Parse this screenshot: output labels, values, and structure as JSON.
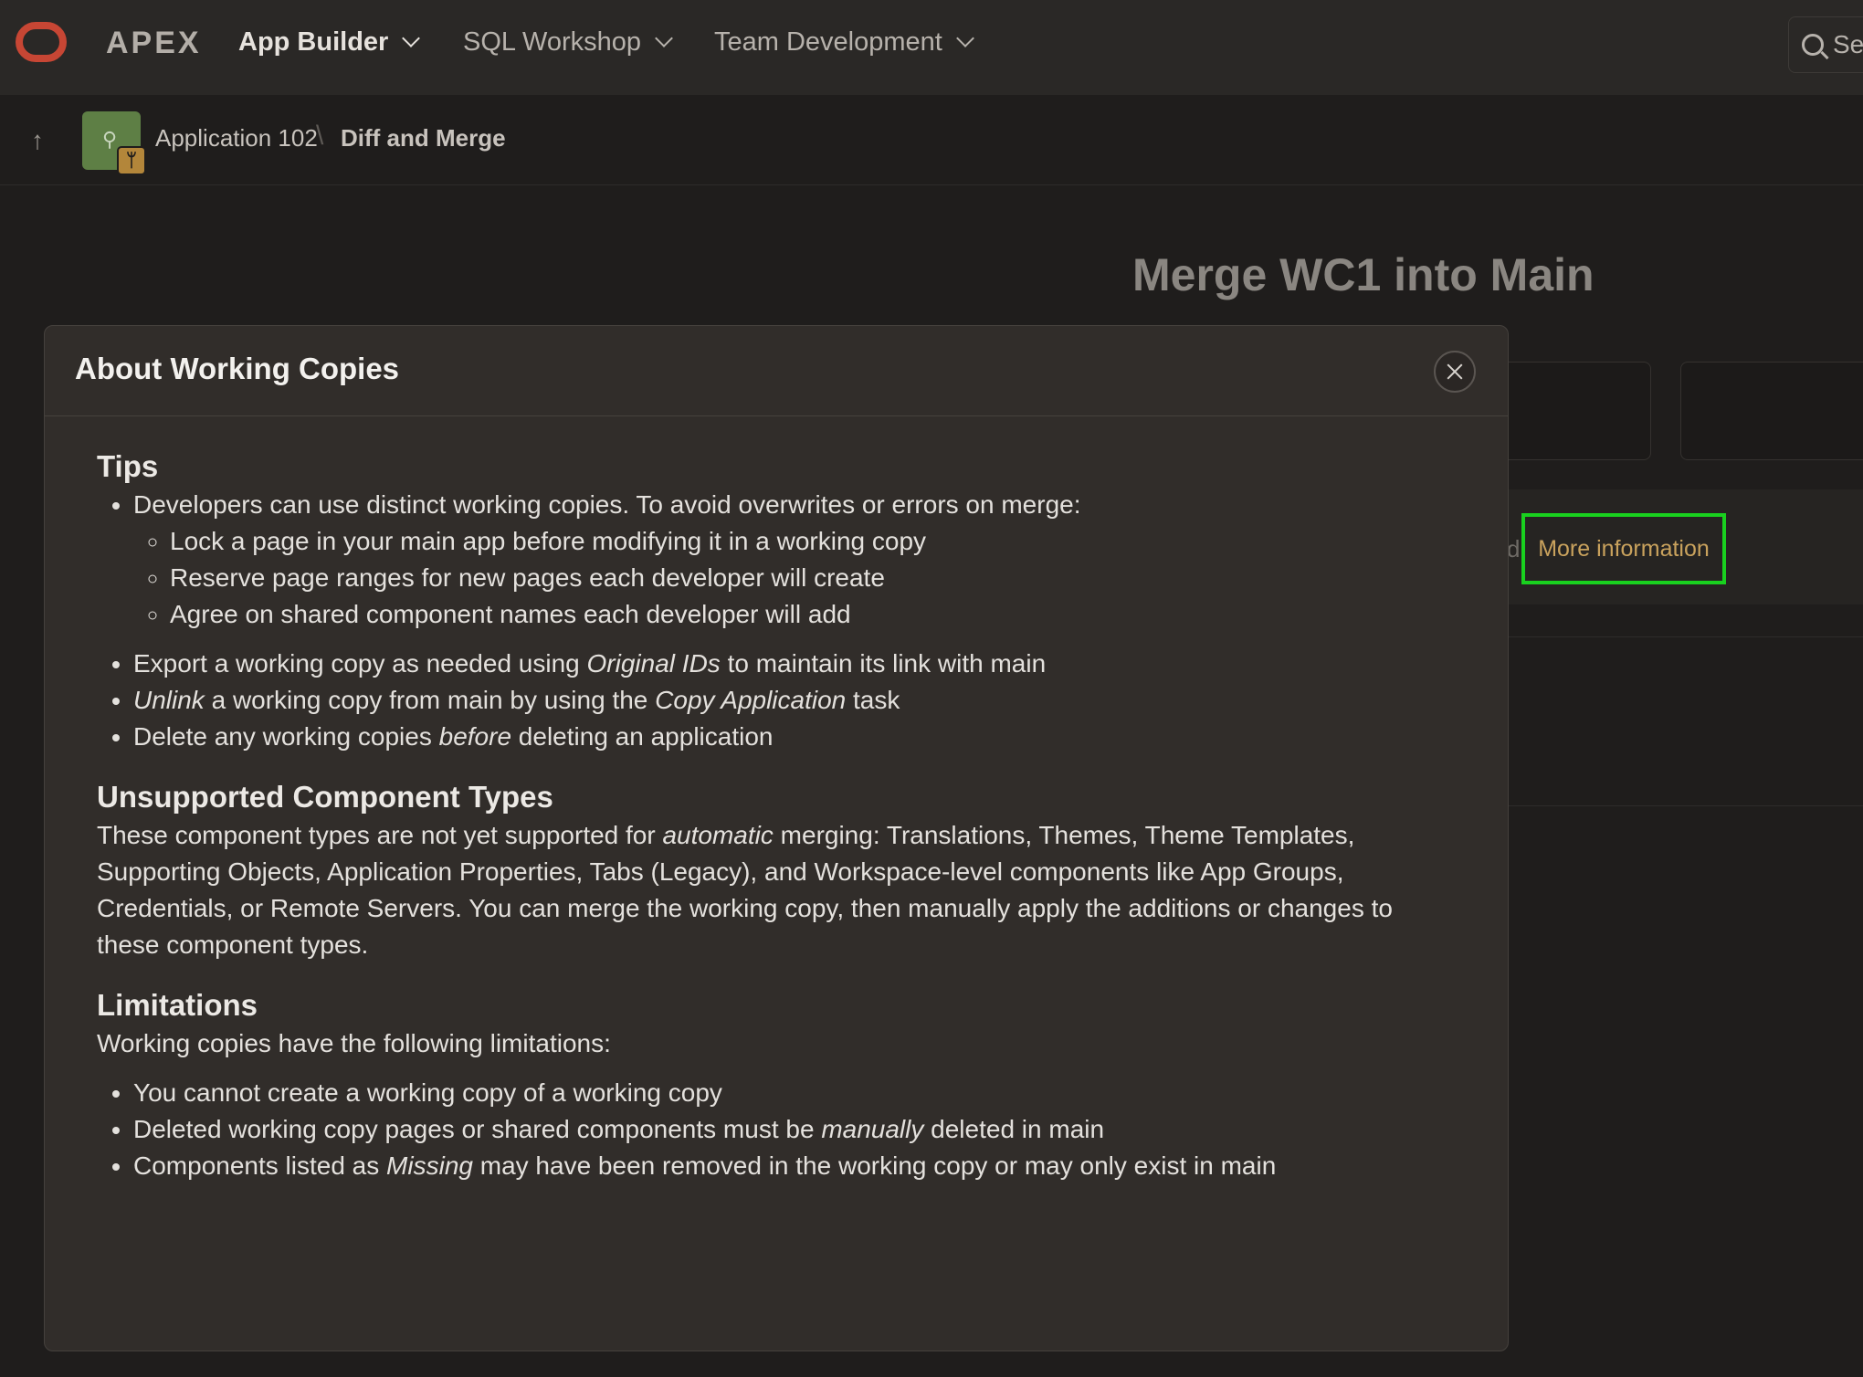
{
  "topbar": {
    "brand": "APEX",
    "nav": [
      {
        "label": "App Builder",
        "active": true
      },
      {
        "label": "SQL Workshop",
        "active": false
      },
      {
        "label": "Team Development",
        "active": false
      }
    ],
    "search_placeholder": "Se",
    "brand_color": "#c74634"
  },
  "breadcrumb": {
    "app": "Application 102",
    "separator": "\\",
    "current": "Diff and Merge"
  },
  "page": {
    "title": "Merge WC1 into Main",
    "stray_char": "d",
    "more_info_label": "More information",
    "highlight_color": "#19d11f"
  },
  "dialog": {
    "title": "About Working Copies",
    "tips": {
      "heading": "Tips",
      "intro": "Developers can use distinct working copies. To avoid overwrites or errors on merge:",
      "sub": [
        "Lock a page in your main app before modifying it in a working copy",
        "Reserve page ranges for new pages each developer will create",
        "Agree on shared component names each developer will add"
      ],
      "b2_pre": "Export a working copy as needed using ",
      "b2_em": "Original IDs",
      "b2_post": " to maintain its link with main",
      "b3_em": "Unlink",
      "b3_mid": " a working copy from main by using the ",
      "b3_em2": "Copy Application",
      "b3_post": " task",
      "b4_pre": "Delete any working copies ",
      "b4_em": "before",
      "b4_post": " deleting an application"
    },
    "unsupported": {
      "heading": "Unsupported Component Types",
      "pre": "These component types are not yet supported for ",
      "em": "automatic",
      "post": " merging: Translations, Themes, Theme Templates, Supporting Objects, Application Properties, Tabs (Legacy), and Workspace-level components like App Groups, Credentials, or Remote Servers. You can merge the working copy, then manually apply the additions or changes to these component types."
    },
    "limitations": {
      "heading": "Limitations",
      "intro": "Working copies have the following limitations:",
      "l1": "You cannot create a working copy of a working copy",
      "l2_pre": "Deleted working copy pages or shared components must be ",
      "l2_em": "manually",
      "l2_post": " deleted in main",
      "l3_pre": "Components listed as ",
      "l3_em": "Missing",
      "l3_post": " may have been removed in the working copy or may only exist in main"
    }
  }
}
